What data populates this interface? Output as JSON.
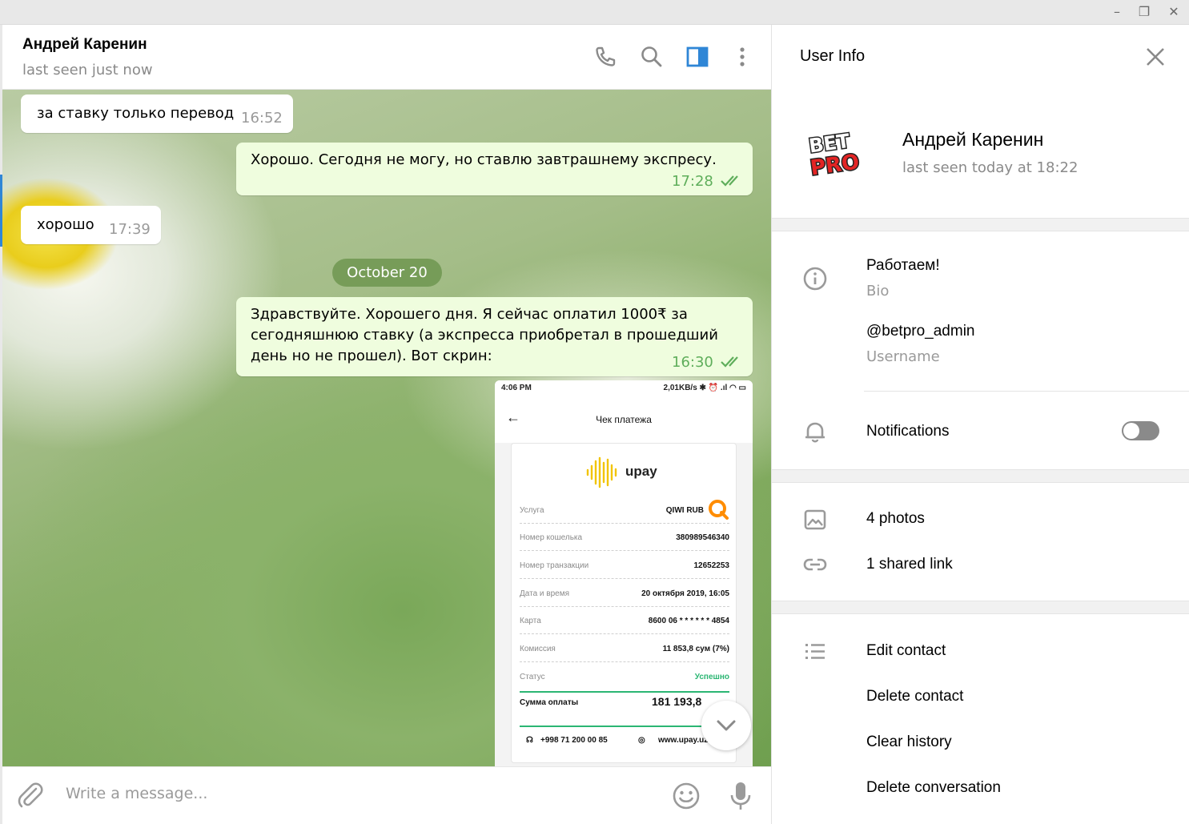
{
  "window": {
    "minimize": "–",
    "restore": "❐",
    "close": "✕"
  },
  "chat": {
    "name": "Андрей Каренин",
    "status": "last seen just now",
    "messages": [
      {
        "dir": "in",
        "text": "за ставку только перевод",
        "time": "16:52"
      },
      {
        "dir": "out",
        "text": "Хорошо. Сегодня не могу, но ставлю завтрашнему экспресу.",
        "time": "17:28"
      },
      {
        "dir": "in",
        "text": "хорошо",
        "time": "17:39"
      },
      {
        "dir": "date",
        "text": "October 20"
      },
      {
        "dir": "out",
        "lines": [
          "Здравствуйте. Хорошего дня. Я сейчас оплатил 1000₹ за",
          "сегодняшнюю ставку (а экспресса приобретал в прошедший",
          "день  но не прошел). Вот скрин:"
        ],
        "time": "16:30"
      }
    ],
    "receipt": {
      "status_time": "4:06 PM",
      "status_right": "2,01KB/s ✱ ⏰ .ıl ◠ ▭",
      "title": "Чек платежа",
      "brand": "upay",
      "rows": [
        {
          "k": "Услуга",
          "v": "QIWI RUB"
        },
        {
          "k": "Номер кошелька",
          "v": "380989546340"
        },
        {
          "k": "Номер транзакции",
          "v": "12652253"
        },
        {
          "k": "Дата и время",
          "v": "20 октября 2019, 16:05"
        },
        {
          "k": "Карта",
          "v": "8600  06 * * * * * *  4854"
        },
        {
          "k": "Комиссия",
          "v": "11 853,8 сум (7%)"
        },
        {
          "k": "Статус",
          "v": "Успешно"
        }
      ],
      "total_label": "Сумма оплаты",
      "total_value": "181 193,8",
      "phone": "+998 71 200 00 85",
      "site": "www.upay.uz"
    },
    "composer_placeholder": "Write a message..."
  },
  "panel": {
    "title": "User Info",
    "avatar_text": "BET PRO",
    "name": "Андрей Каренин",
    "last_seen": "last seen today at 18:22",
    "bio": "Работаем!",
    "bio_label": "Bio",
    "username": "@betpro_admin",
    "username_label": "Username",
    "notifications_label": "Notifications",
    "notifications_on": false,
    "photos": "4 photos",
    "shared_links": "1 shared link",
    "actions": [
      "Edit contact",
      "Delete contact",
      "Clear history",
      "Delete conversation"
    ]
  },
  "colors": {
    "accent": "#2f86d6",
    "out_bubble": "#effdde",
    "check_green": "#5fae5b"
  },
  "icons": [
    "phone-icon",
    "search-icon",
    "sidebar-toggle-icon",
    "more-icon",
    "close-icon",
    "info-icon",
    "bell-icon",
    "photo-icon",
    "link-icon",
    "list-icon",
    "attach-icon",
    "emoji-icon",
    "mic-icon",
    "chevron-down-icon",
    "double-check-icon"
  ]
}
